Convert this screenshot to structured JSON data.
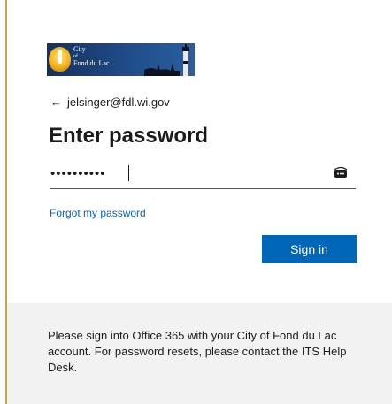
{
  "logo": {
    "alt": "City of Fond du Lac",
    "line1": "City",
    "line2": "of",
    "line3": "Fond du Lac"
  },
  "account": {
    "back_icon": "back-arrow-icon",
    "email": "jelsinger@fdl.wi.gov"
  },
  "title": "Enter password",
  "password": {
    "masked_value": "••••••••••",
    "reveal_icon": "show-password-icon"
  },
  "forgot_link": "Forgot my password",
  "signin_button": "Sign in",
  "footer": {
    "text": "Please sign into Office 365 with your City of Fond du Lac account. For password resets, please contact the ITS Help Desk."
  },
  "colors": {
    "accent": "#0067b8",
    "footer_bg": "#f2f2f2",
    "text": "#1b1b1b"
  }
}
